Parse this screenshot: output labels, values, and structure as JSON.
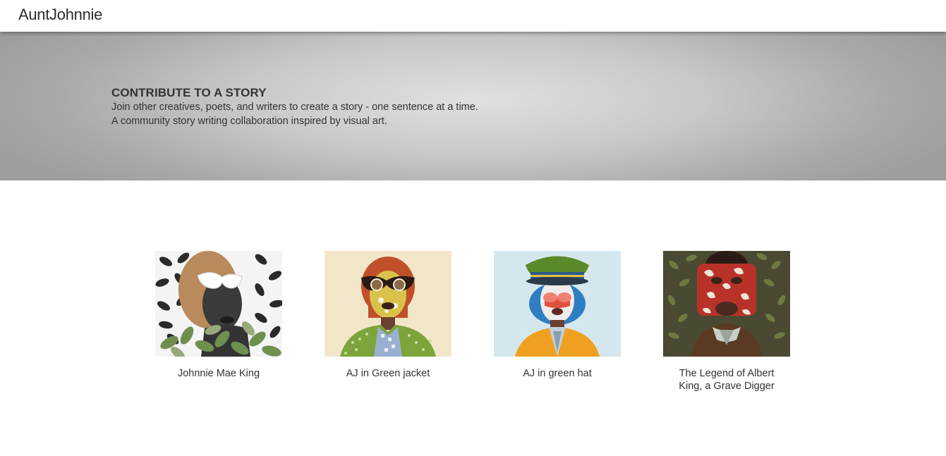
{
  "nav": {
    "brand": "AuntJohnnie"
  },
  "hero": {
    "title": "CONTRIBUTE TO A STORY",
    "line1": "Join other creatives, poets, and writers to create a story - one sentence at a time.",
    "line2": "A community story writing collaboration inspired by visual art."
  },
  "stories": [
    {
      "title": "Johnnie Mae King",
      "image": "portrait-artwork"
    },
    {
      "title": "AJ in Green jacket",
      "image": "portrait-artwork"
    },
    {
      "title": "AJ in green hat",
      "image": "portrait-artwork"
    },
    {
      "title": "The Legend of Albert King, a Grave Digger",
      "image": "portrait-artwork"
    }
  ]
}
